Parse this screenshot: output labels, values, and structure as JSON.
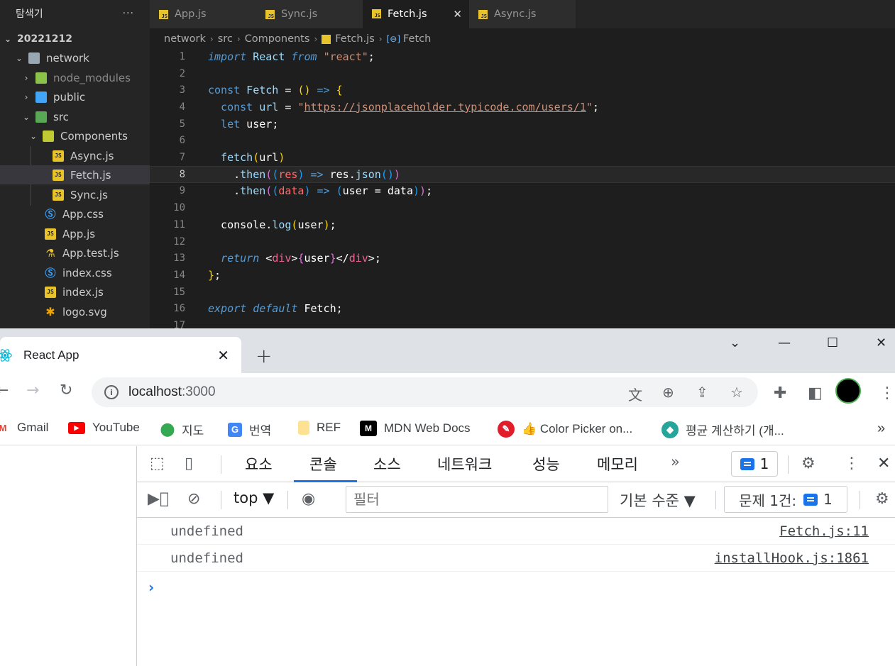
{
  "explorer": {
    "title": "탐색기",
    "more": "···",
    "items": [
      {
        "label": "20221212",
        "kind": "root"
      },
      {
        "label": "network",
        "kind": "folder"
      },
      {
        "label": "node_modules",
        "kind": "folder"
      },
      {
        "label": "public",
        "kind": "folder"
      },
      {
        "label": "src",
        "kind": "folder"
      },
      {
        "label": "Components",
        "kind": "folder"
      },
      {
        "label": "Async.js",
        "kind": "js"
      },
      {
        "label": "Fetch.js",
        "kind": "js"
      },
      {
        "label": "Sync.js",
        "kind": "js"
      },
      {
        "label": "App.css",
        "kind": "css"
      },
      {
        "label": "App.js",
        "kind": "js"
      },
      {
        "label": "App.test.js",
        "kind": "test"
      },
      {
        "label": "index.css",
        "kind": "css"
      },
      {
        "label": "index.js",
        "kind": "js"
      },
      {
        "label": "logo.svg",
        "kind": "svg"
      }
    ]
  },
  "editor": {
    "tabs": [
      {
        "label": "App.js",
        "active": false
      },
      {
        "label": "Sync.js",
        "active": false
      },
      {
        "label": "Fetch.js",
        "active": true
      },
      {
        "label": "Async.js",
        "active": false
      }
    ],
    "tab_close": "✕",
    "breadcrumb": [
      "network",
      "src",
      "Components",
      "Fetch.js",
      "Fetch"
    ],
    "line_numbers": [
      "1",
      "2",
      "3",
      "4",
      "5",
      "6",
      "7",
      "8",
      "9",
      "10",
      "11",
      "12",
      "13",
      "14",
      "15",
      "16",
      "17"
    ],
    "code": {
      "l1_import": "import",
      "l1_react": " React ",
      "l1_from": "from",
      "l1_str": "\"react\"",
      "l1_end": ";",
      "l3_const": "const",
      "l3_name": " Fetch ",
      "l3_eq": "= ",
      "l3_paren": "()",
      "l3_arrow": " => ",
      "l3_brace": "{",
      "l4_const": "  const",
      "l4_var": " url",
      "l4_eq": " = ",
      "l4_q1": "\"",
      "l4_url": "https://jsonplaceholder.typicode.com/users/1",
      "l4_q2": "\"",
      "l4_end": ";",
      "l5_let": "  let",
      "l5_var": " user",
      "l5_end": ";",
      "l7_fn": "  fetch",
      "l7_p1": "(",
      "l7_arg": "url",
      "l7_p2": ")",
      "l8_dot": "    .",
      "l8_then": "then",
      "l8_p1": "(",
      "l8_p2": "(",
      "l8_res": "res",
      "l8_p3": ")",
      "l8_arrow": " => ",
      "l8_obj": "res",
      "l8_dot2": ".",
      "l8_json": "json",
      "l8_p4": "()",
      "l8_p5": ")",
      "l9_dot": "    .",
      "l9_then": "then",
      "l9_p1": "(",
      "l9_p2": "(",
      "l9_data": "data",
      "l9_p3": ")",
      "l9_arrow": " => ",
      "l9_p4": "(",
      "l9_user": "user",
      "l9_eq": " = ",
      "l9_data2": "data",
      "l9_p5": ")",
      "l9_p6": ")",
      "l9_end": ";",
      "l11_console": "  console",
      "l11_dot": ".",
      "l11_log": "log",
      "l11_p1": "(",
      "l11_user": "user",
      "l11_p2": ")",
      "l11_end": ";",
      "l13_return": "  return",
      "l13_open": " <",
      "l13_div1": "div",
      "l13_gt1": ">",
      "l13_b1": "{",
      "l13_user": "user",
      "l13_b2": "}",
      "l13_close": "</",
      "l13_div2": "div",
      "l13_gt2": ">",
      "l13_end": ";",
      "l14_brace": "}",
      "l14_end": ";",
      "l16_export": "export",
      "l16_default": " default",
      "l16_name": " Fetch",
      "l16_end": ";"
    }
  },
  "browser": {
    "tab_title": "React App",
    "tab_close": "✕",
    "new_tab": "+",
    "window_controls": [
      "⌄",
      "—",
      "☐",
      "✕"
    ],
    "url_host": "localhost",
    "url_port": ":3000",
    "bookmarks": [
      {
        "label": "Gmail",
        "icon": "gmail-icon"
      },
      {
        "label": "YouTube",
        "icon": "youtube-icon"
      },
      {
        "label": "지도",
        "icon": "maps-icon"
      },
      {
        "label": "번역",
        "icon": "translate-icon"
      },
      {
        "label": "REF",
        "icon": "folder-icon"
      },
      {
        "label": "MDN Web Docs",
        "icon": "mdn-icon"
      },
      {
        "label": "👍 Color Picker on...",
        "icon": "color-picker-icon"
      },
      {
        "label": "평균 계산하기 (개...",
        "icon": "calc-icon"
      }
    ],
    "bookmarks_more": "»"
  },
  "devtools": {
    "tabs": [
      "요소",
      "콘솔",
      "소스",
      "네트워크",
      "성능",
      "메모리"
    ],
    "active_tab": "콘솔",
    "more_tabs": "»",
    "issues_badge": "1",
    "context": "top ▼",
    "filter_placeholder": "필터",
    "level": "기본 수준 ▼",
    "issues_label": "문제 1건:",
    "issues_count": "1",
    "logs": [
      {
        "message": "undefined",
        "source": "Fetch.js:11"
      },
      {
        "message": "undefined",
        "source": "installHook.js:1861"
      }
    ],
    "prompt": "›"
  },
  "colors": {
    "editor_bg": "#1e1e1e",
    "sidebar_bg": "#252526",
    "accent_blue": "#1a73e8",
    "js_yellow": "#e8c42a"
  }
}
